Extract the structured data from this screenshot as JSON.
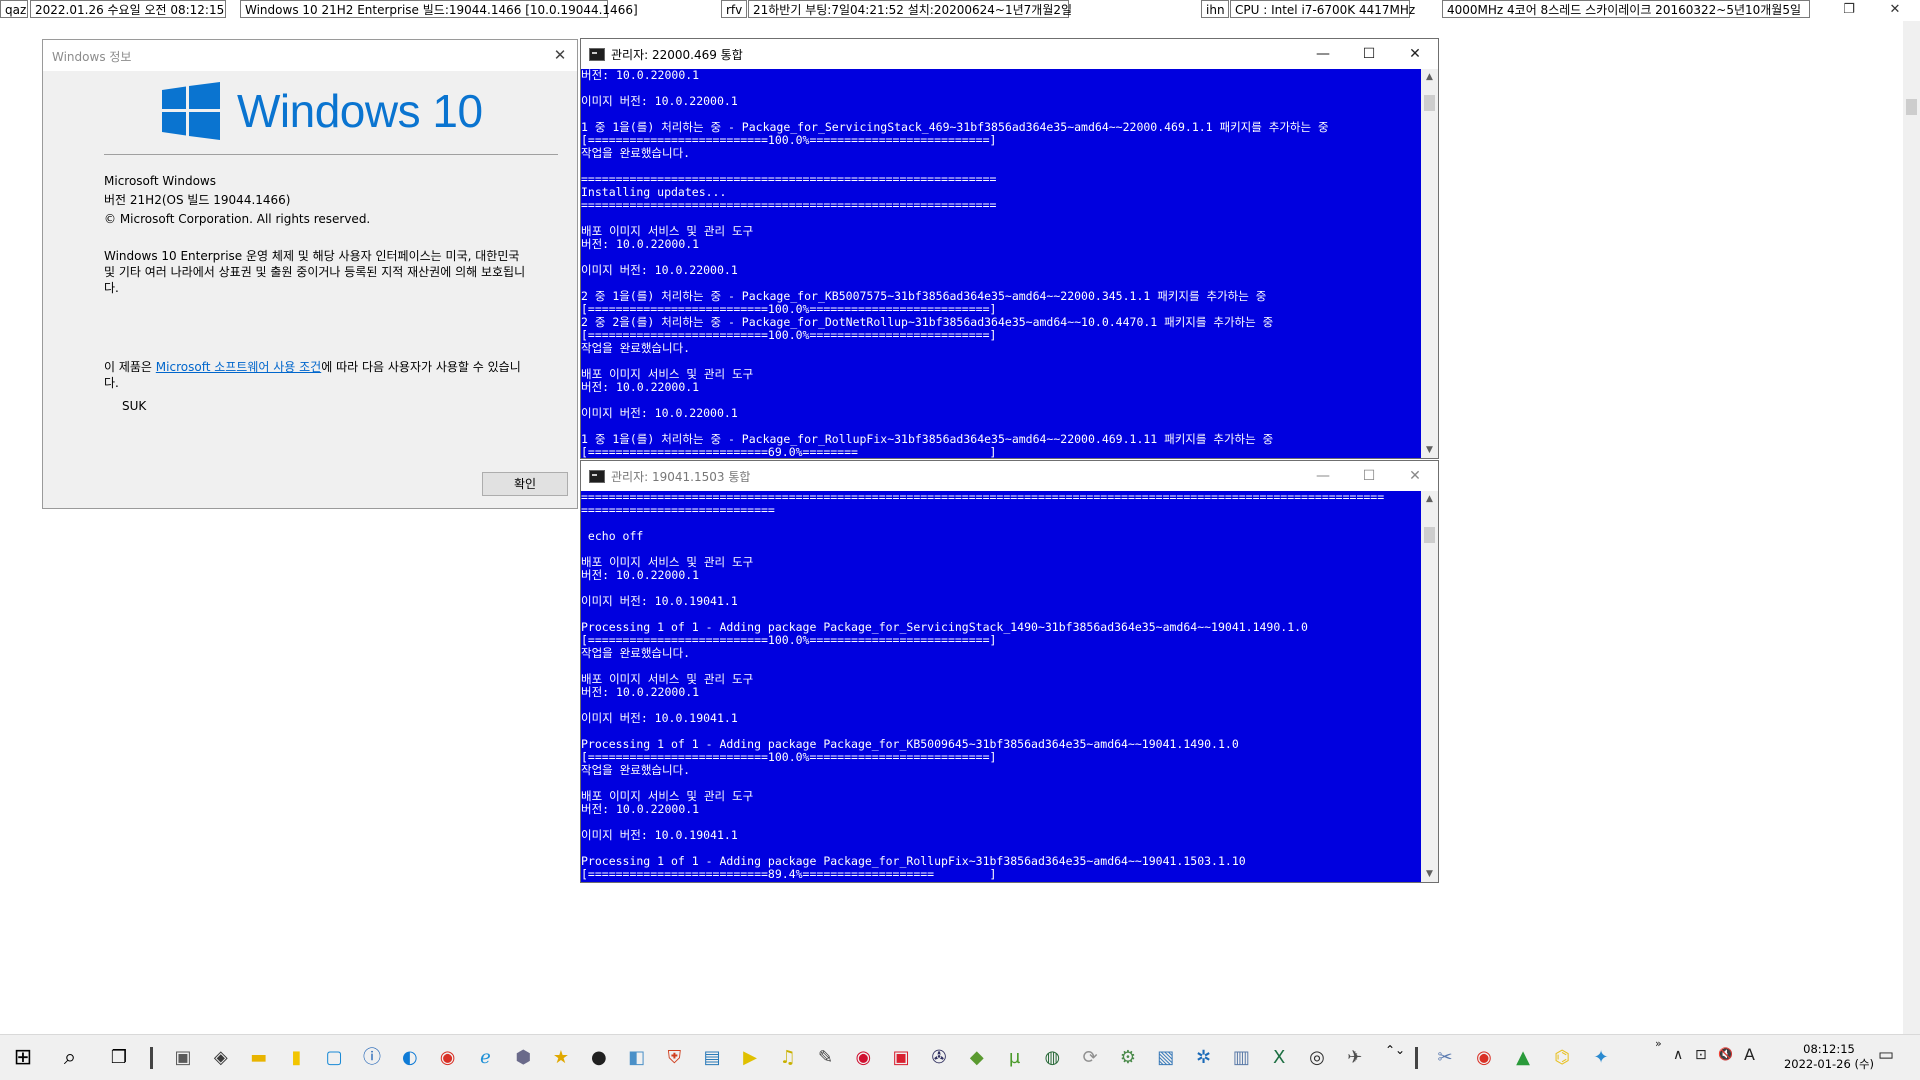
{
  "topbar": {
    "cells": [
      "qaz",
      "2022.01.26 수요일 오전 08:12:15",
      "Windows 10 21H2 Enterprise 빌드:19044.1466 [10.0.19044.1466]",
      "rfv",
      "21하반기 부팅:7일04:21:52 설치:20200624~1년7개월2일",
      "ihn",
      "CPU : Intel i7-6700K 4417MHz",
      "4000MHz 4코어 8스레드 스카이레이크 20160322~5년10개월5일"
    ],
    "restore_glyph": "❐",
    "close_glyph": "✕"
  },
  "about": {
    "title": "Windows 정보",
    "logo_text": "Windows 10",
    "product": "Microsoft Windows",
    "version": "버전 21H2(OS 빌드 19044.1466)",
    "copyright": "© Microsoft Corporation. All rights reserved.",
    "legal": "Windows 10 Enterprise 운영 체제 및 해당 사용자 인터페이스는 미국, 대한민국 및 기타 여러 나라에서 상표권 및 출원 중이거나 등록된 지적 재산권에 의해 보호됩니다.",
    "license_prefix": "이 제품은 ",
    "license_link": "Microsoft 소프트웨어 사용 조건",
    "license_suffix": "에 따라 다음 사용자가 사용할 수 있습니다.",
    "user": "SUK",
    "ok_label": "확인",
    "close_glyph": "✕"
  },
  "console1": {
    "title": "관리자:  22000.469 통합",
    "lines": [
      "버전: 10.0.22000.1",
      "",
      "이미지 버전: 10.0.22000.1",
      "",
      "1 중 1을(를) 처리하는 중 - Package_for_ServicingStack_469~31bf3856ad364e35~amd64~~22000.469.1.1 패키지를 추가하는 중",
      "[==========================100.0%==========================]",
      "작업을 완료했습니다.",
      "",
      "============================================================",
      "Installing updates...",
      "============================================================",
      "",
      "배포 이미지 서비스 및 관리 도구",
      "버전: 10.0.22000.1",
      "",
      "이미지 버전: 10.0.22000.1",
      "",
      "2 중 1을(를) 처리하는 중 - Package_for_KB5007575~31bf3856ad364e35~amd64~~22000.345.1.1 패키지를 추가하는 중",
      "[==========================100.0%==========================]",
      "2 중 2을(를) 처리하는 중 - Package_for_DotNetRollup~31bf3856ad364e35~amd64~~10.0.4470.1 패키지를 추가하는 중",
      "[==========================100.0%==========================]",
      "작업을 완료했습니다.",
      "",
      "배포 이미지 서비스 및 관리 도구",
      "버전: 10.0.22000.1",
      "",
      "이미지 버전: 10.0.22000.1",
      "",
      "1 중 1을(를) 처리하는 중 - Package_for_RollupFix~31bf3856ad364e35~amd64~~22000.469.1.11 패키지를 추가하는 중",
      "[==========================69.0%========                   ]"
    ]
  },
  "console2": {
    "title": "관리자:  19041.1503 통합",
    "lines": [
      "====================================================================================================================",
      "============================",
      "",
      " echo off",
      "",
      "배포 이미지 서비스 및 관리 도구",
      "버전: 10.0.22000.1",
      "",
      "이미지 버전: 10.0.19041.1",
      "",
      "Processing 1 of 1 - Adding package Package_for_ServicingStack_1490~31bf3856ad364e35~amd64~~19041.1490.1.0",
      "[==========================100.0%==========================]",
      "작업을 완료했습니다.",
      "",
      "배포 이미지 서비스 및 관리 도구",
      "버전: 10.0.22000.1",
      "",
      "이미지 버전: 10.0.19041.1",
      "",
      "Processing 1 of 1 - Adding package Package_for_KB5009645~31bf3856ad364e35~amd64~~19041.1490.1.0",
      "[==========================100.0%==========================]",
      "작업을 완료했습니다.",
      "",
      "배포 이미지 서비스 및 관리 도구",
      "버전: 10.0.22000.1",
      "",
      "이미지 버전: 10.0.19041.1",
      "",
      "Processing 1 of 1 - Adding package Package_for_RollupFix~31bf3856ad364e35~amd64~~19041.1503.1.10",
      "[==========================89.4%===================        ]"
    ]
  },
  "window_controls": {
    "minimize": "—",
    "maximize": "☐",
    "close": "✕"
  },
  "taskbar": {
    "start": "⊞",
    "search": "⌕",
    "taskview": "❐",
    "apps": [
      {
        "name": "system-tool-icon",
        "glyph": "▣",
        "color": "#5a5a5a"
      },
      {
        "name": "network-icon",
        "glyph": "◈",
        "color": "#3a3a3a"
      },
      {
        "name": "file-explorer-icon",
        "glyph": "▬",
        "color": "#e8b400"
      },
      {
        "name": "notes-icon",
        "glyph": "▮",
        "color": "#f2c500"
      },
      {
        "name": "snip-icon",
        "glyph": "▢",
        "color": "#1a8ad6"
      },
      {
        "name": "info-icon",
        "glyph": "ⓘ",
        "color": "#1a5fb4"
      },
      {
        "name": "edge-icon",
        "glyph": "◐",
        "color": "#0f7bd6"
      },
      {
        "name": "chrome-icon",
        "glyph": "◉",
        "color": "#d93025"
      },
      {
        "name": "ie-icon",
        "glyph": "ℯ",
        "color": "#1e90d6"
      },
      {
        "name": "cube-icon",
        "glyph": "⬢",
        "color": "#6a6a8a"
      },
      {
        "name": "star-icon",
        "glyph": "★",
        "color": "#e0a800"
      },
      {
        "name": "media-icon",
        "glyph": "●",
        "color": "#202020"
      },
      {
        "name": "app-icon",
        "glyph": "◧",
        "color": "#4a90c8"
      },
      {
        "name": "shield-icon",
        "glyph": "⛨",
        "color": "#d04020"
      },
      {
        "name": "remote-icon",
        "glyph": "▤",
        "color": "#2a7ab8"
      },
      {
        "name": "player-icon",
        "glyph": "▶",
        "color": "#e0c000"
      },
      {
        "name": "mp3-icon",
        "glyph": "♫",
        "color": "#c8b000"
      },
      {
        "name": "edit-icon",
        "glyph": "✎",
        "color": "#404040"
      },
      {
        "name": "record-icon",
        "glyph": "◉",
        "color": "#d01030"
      },
      {
        "name": "video-icon",
        "glyph": "▣",
        "color": "#d82030"
      },
      {
        "name": "tool-icon",
        "glyph": "✇",
        "color": "#303060"
      },
      {
        "name": "map-icon",
        "glyph": "◆",
        "color": "#5a9a30"
      },
      {
        "name": "torrent-icon",
        "glyph": "µ",
        "color": "#4a9a2a"
      },
      {
        "name": "globe-icon",
        "glyph": "◍",
        "color": "#2a6a3a"
      },
      {
        "name": "sync-icon",
        "glyph": "⟳",
        "color": "#909090"
      },
      {
        "name": "settings-app-icon",
        "glyph": "⚙",
        "color": "#4a8a4a"
      },
      {
        "name": "document-icon",
        "glyph": "▧",
        "color": "#3a7ab8"
      },
      {
        "name": "gear-icon",
        "glyph": "✲",
        "color": "#1a6ab8"
      },
      {
        "name": "database-icon",
        "glyph": "▥",
        "color": "#5a7aa8"
      },
      {
        "name": "excel-icon",
        "glyph": "X",
        "color": "#1d6f42"
      },
      {
        "name": "capture-icon",
        "glyph": "◎",
        "color": "#303030"
      },
      {
        "name": "plane-icon",
        "glyph": "✈",
        "color": "#505050"
      }
    ],
    "chevron": "⌃⌄",
    "pinned": [
      {
        "name": "scissors-icon",
        "glyph": "✂",
        "color": "#5a7ab0"
      },
      {
        "name": "chrome-pinned-icon",
        "glyph": "◉",
        "color": "#d93025"
      },
      {
        "name": "drive-icon",
        "glyph": "▲",
        "color": "#2a9a3a"
      },
      {
        "name": "folder-pinned-icon",
        "glyph": "⌬",
        "color": "#e8c020"
      },
      {
        "name": "paint-icon",
        "glyph": "✦",
        "color": "#2a8ad0"
      }
    ],
    "tray": {
      "more": "»",
      "up_arrow": "∧",
      "network": "⊡",
      "volume": "🔇",
      "ime": "A",
      "notification": "▭"
    },
    "clock_time": "08:12:15",
    "clock_date": "2022-01-26 (수)"
  }
}
